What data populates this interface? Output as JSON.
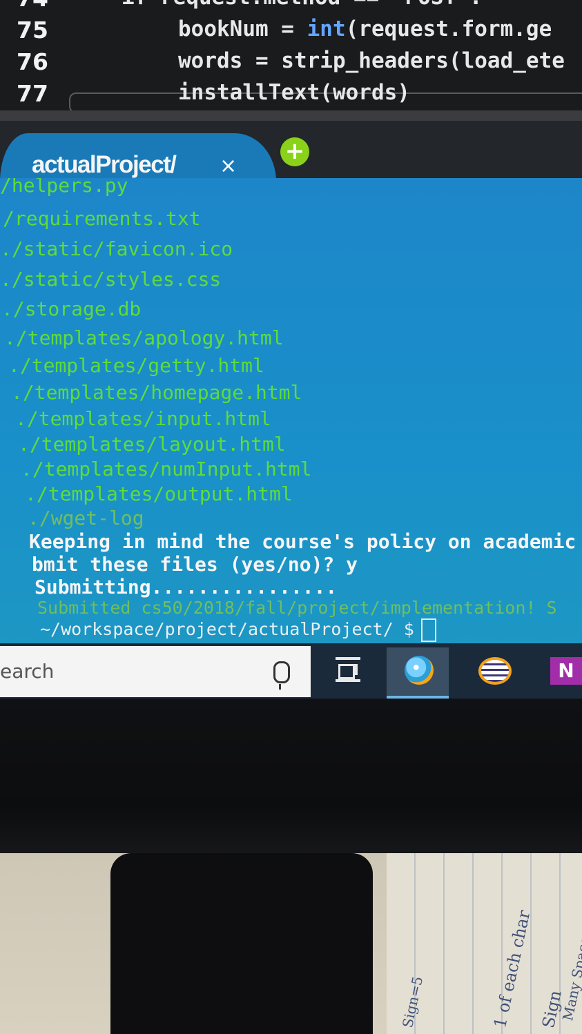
{
  "editor": {
    "partial_top_line": "if request.method == \"POST\":",
    "lines": [
      {
        "num": "75",
        "kw_before": "bookNum = ",
        "kw": "int",
        "after": "(request.form.ge"
      },
      {
        "num": "76",
        "kw_before": "words = strip_headers(load_ete",
        "kw": "",
        "after": ""
      },
      {
        "num": "77",
        "kw_before": "installText(words)",
        "kw": "",
        "after": ""
      }
    ]
  },
  "terminal_tab": {
    "label": "actualProject/",
    "close_glyph": "×",
    "add_glyph": "+"
  },
  "terminal": {
    "partial_top": "/helpers.py",
    "files": [
      "/requirements.txt",
      "./static/favicon.ico",
      "./static/styles.css",
      "./storage.db",
      "./templates/apology.html",
      "./templates/getty.html",
      "./templates/homepage.html",
      "./templates/input.html",
      "./templates/layout.html",
      "./templates/numInput.html",
      "./templates/output.html",
      "./wget-log"
    ],
    "policy_line": "Keeping in mind the course's policy on academic h",
    "confirm_line": "bmit these files (yes/no)? y",
    "submitting_line": "Submitting................",
    "submitted_line": "Submitted cs50/2018/fall/project/implementation! S",
    "prompt": "~/workspace/project/actualProject/ $"
  },
  "taskbar": {
    "search_text": "earch",
    "icons": [
      "microphone-icon",
      "task-view-icon",
      "edge-icon",
      "eclipse-icon",
      "onenote-icon"
    ]
  },
  "desk": {
    "scribbles": [
      "Sign=5",
      "1 of each char",
      "Sign",
      "Many Spaces"
    ]
  },
  "colors": {
    "terminal_bg": "#1990c9",
    "path_green": "#5fdb3c",
    "taskbar": "#1b2a3a"
  }
}
